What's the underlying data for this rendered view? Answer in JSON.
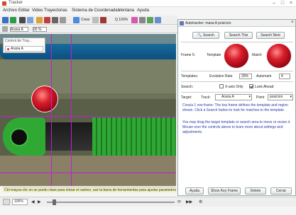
{
  "window": {
    "title": "Tracker"
  },
  "menu": [
    "Archivo",
    "Editar",
    "Video",
    "Trayectorias",
    "Sistema de Coordenadas",
    "Ventana",
    "Ayuda"
  ],
  "toolbar": {
    "create_label": "Crear",
    "zoom_label": "Q 100%"
  },
  "subbar": {
    "track_name": "Arana A",
    "value": "00 %"
  },
  "track_panel": {
    "header": "Control de Tray...",
    "item": "Arana A"
  },
  "video": {
    "status_text": "Ctrl-mayus-clic en un punto clave para iniciar el rastreo; use la barra de herramientas para ajustar parametros"
  },
  "playbar": {
    "zoom": "100%"
  },
  "dialog": {
    "title": "Autotracker: masa A posicion",
    "buttons": {
      "search": "Search",
      "search_this": "Search This",
      "search_next": "Search Next"
    },
    "frame_label": "Frame 5:",
    "template_label": "Template",
    "match_label": "Match",
    "templates_label": "Templates:",
    "evolution_label": "Evolution Rate",
    "evolution_value": "20%",
    "autoskip_label": "Automark",
    "autoskip_value": "4",
    "search_label": "Search:",
    "xaxis_only": "X-axis Only",
    "look_ahead": "Look Ahead",
    "target_label": "Target:",
    "track_label": "Track:",
    "track_value": "Arana A",
    "point_label": "Point",
    "point_value": "posicion",
    "info1": "Crea/a 1 row frame: The key frame defines the template and region shown. Click a Search button to look for matches to the template.",
    "info2": "You may drag the target template or search area to move or resize it. Mouse over the controls above to learn more about settings and adjustments.",
    "footer": {
      "help": "Ayuda",
      "show_key": "Show Key Frame",
      "delete": "Delete",
      "close": "Cerrar"
    }
  },
  "colors": {
    "accent": "#2a3aa8",
    "guide": "#c020d0",
    "apple": "#d81e2a",
    "green": "#3aa23a"
  }
}
